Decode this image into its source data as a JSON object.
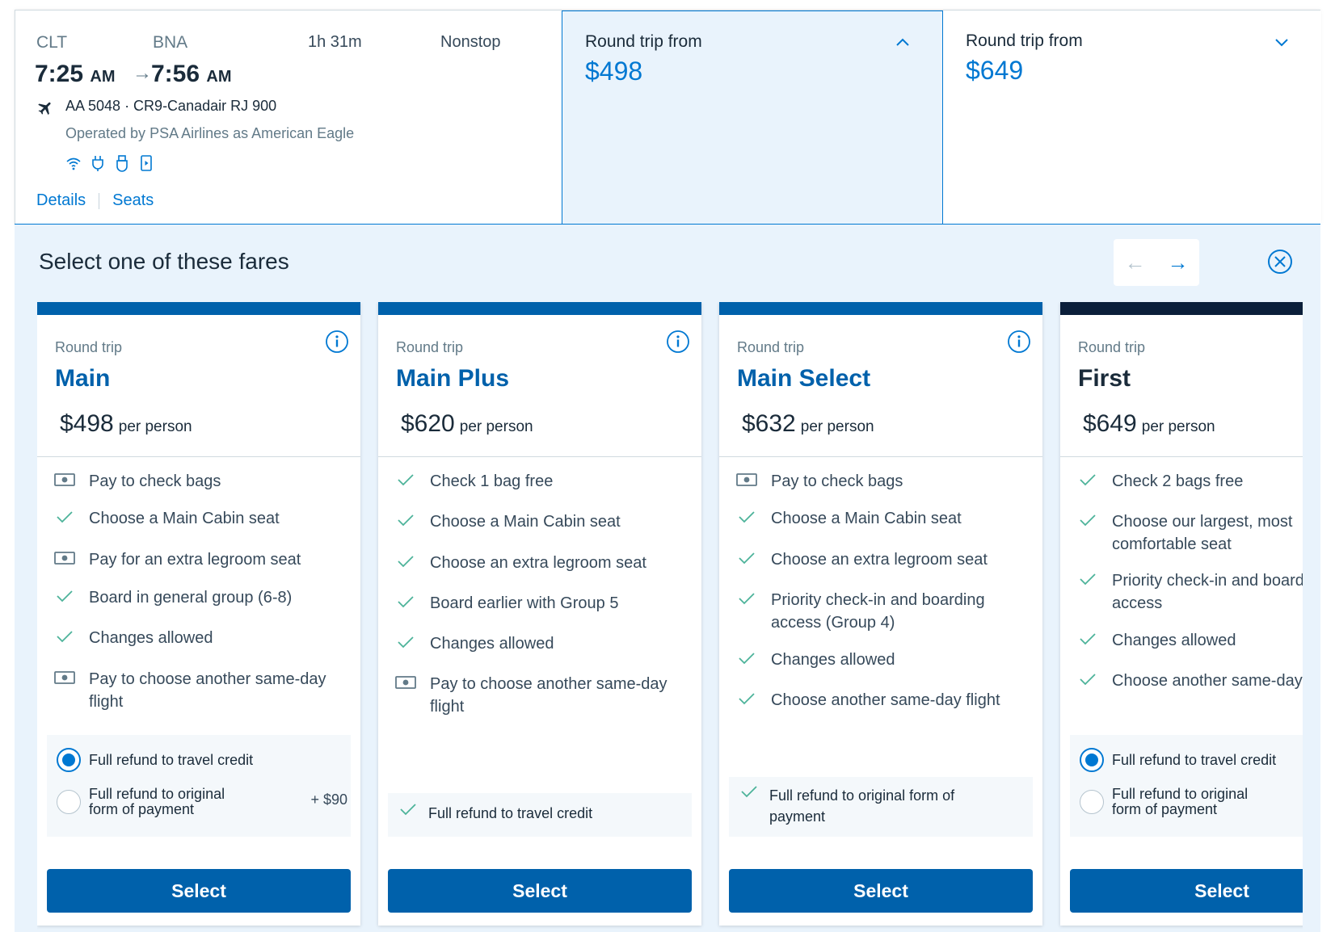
{
  "flight": {
    "origin": "CLT",
    "destination": "BNA",
    "depart_time": "7:25",
    "depart_ampm": "AM",
    "arrive_time": "7:56",
    "arrive_ampm": "AM",
    "duration": "1h 31m",
    "stops": "Nonstop",
    "flight_number": "AA 5048 · CR9-Canadair RJ 900",
    "operated_by": "Operated by PSA Airlines as American Eagle",
    "amenities": [
      "wifi-icon",
      "power-outlet-icon",
      "usb-icon",
      "entertainment-icon"
    ],
    "details_link": "Details",
    "seats_link": "Seats"
  },
  "price_tabs": [
    {
      "label": "Round trip from",
      "price": "$498",
      "selected": true
    },
    {
      "label": "Round trip from",
      "price": "$649",
      "selected": false
    }
  ],
  "panel": {
    "title": "Select one of these fares",
    "prev_icon": "←",
    "next_icon": "→"
  },
  "fares": [
    {
      "type": "Round trip",
      "name": "Main",
      "price": "$498",
      "per": "per person",
      "features": [
        {
          "icon": "money",
          "text": "Pay to check bags"
        },
        {
          "icon": "check",
          "text": "Choose a Main Cabin seat"
        },
        {
          "icon": "money",
          "text": "Pay for an extra legroom seat"
        },
        {
          "icon": "check",
          "text": "Board in general group (6-8)"
        },
        {
          "icon": "check",
          "text": "Changes allowed"
        },
        {
          "icon": "money",
          "text": "Pay to choose another same-day flight"
        }
      ],
      "refund_options": [
        {
          "label": "Full refund to travel credit",
          "selected": true,
          "extra": ""
        },
        {
          "label": "Full refund to original form of payment",
          "selected": false,
          "extra": "+ $90"
        }
      ],
      "select_label": "Select"
    },
    {
      "type": "Round trip",
      "name": "Main Plus",
      "price": "$620",
      "per": "per person",
      "features": [
        {
          "icon": "check",
          "text": "Check 1 bag free"
        },
        {
          "icon": "check",
          "text": "Choose a Main Cabin seat"
        },
        {
          "icon": "check",
          "text": "Choose an extra legroom seat"
        },
        {
          "icon": "check",
          "text": "Board earlier with Group 5"
        },
        {
          "icon": "check",
          "text": "Changes allowed"
        },
        {
          "icon": "money",
          "text": "Pay to choose another same-day flight"
        }
      ],
      "refund_included": "Full refund to travel credit",
      "select_label": "Select"
    },
    {
      "type": "Round trip",
      "name": "Main Select",
      "price": "$632",
      "per": "per person",
      "features": [
        {
          "icon": "money",
          "text": "Pay to check bags"
        },
        {
          "icon": "check",
          "text": "Choose a Main Cabin seat"
        },
        {
          "icon": "check",
          "text": "Choose an extra legroom seat"
        },
        {
          "icon": "check",
          "text": "Priority check-in and boarding access (Group 4)"
        },
        {
          "icon": "check",
          "text": "Changes allowed"
        },
        {
          "icon": "check",
          "text": "Choose another same-day flight"
        }
      ],
      "refund_included": "Full refund to original form of payment",
      "select_label": "Select"
    },
    {
      "type": "Round trip",
      "name": "First",
      "price": "$649",
      "per": "per person",
      "features": [
        {
          "icon": "check",
          "text": "Check 2 bags free"
        },
        {
          "icon": "check",
          "text": "Choose our largest, most comfortable seat"
        },
        {
          "icon": "check",
          "text": "Priority check-in and boarding access"
        },
        {
          "icon": "check",
          "text": "Changes allowed"
        },
        {
          "icon": "check",
          "text": "Choose another same-day flight"
        }
      ],
      "refund_options": [
        {
          "label": "Full refund to travel credit",
          "selected": true,
          "extra": ""
        },
        {
          "label": "Full refund to original form of payment",
          "selected": false,
          "extra": ""
        }
      ],
      "select_label": "Select"
    }
  ]
}
